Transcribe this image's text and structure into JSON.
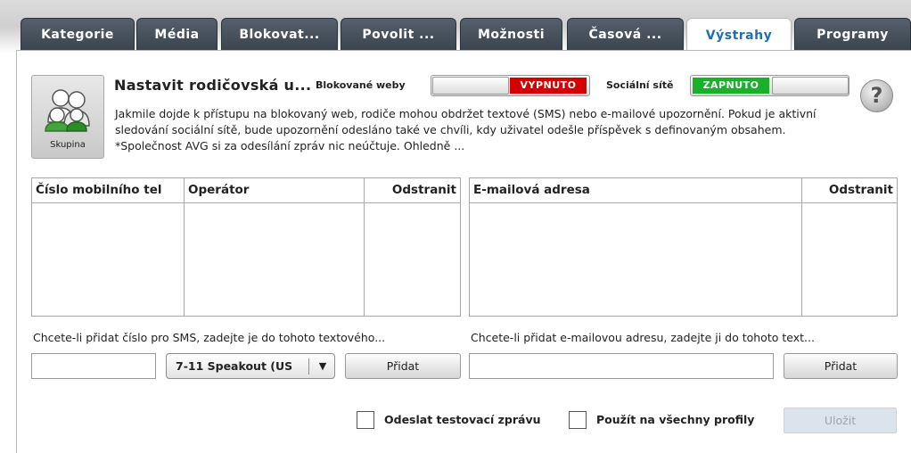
{
  "tabs": [
    {
      "label": "Kategorie"
    },
    {
      "label": "Média"
    },
    {
      "label": "Blokovat..."
    },
    {
      "label": "Povolit ..."
    },
    {
      "label": "Možnosti"
    },
    {
      "label": "Časová ..."
    },
    {
      "label": "Výstrahy",
      "active": true
    },
    {
      "label": "Programy"
    }
  ],
  "group_button": {
    "label": "Skupina",
    "icon": "group-icon"
  },
  "heading": "Nastavit rodičovská u...",
  "switches": {
    "blocked_sites": {
      "label": "Blokované weby",
      "state": "VYPNUTO",
      "color": "#d40000"
    },
    "social": {
      "label": "Sociální sítě",
      "state": "ZAPNUTO",
      "color": "#1ab02a"
    }
  },
  "help": {
    "glyph": "?"
  },
  "description": "Jakmile dojde k přístupu na blokovaný web, rodiče mohou obdržet textové (SMS) nebo e-mailové upozornění.  Pokud je aktivní sledování sociální sítě, bude upozornění odesláno také ve chvíli, kdy uživatel odešle příspěvek s definovaným obsahem.  *Společnost AVG si za odesílání zpráv nic neúčtuje.  Ohledně ...",
  "sms_table": {
    "columns": [
      "Číslo mobilního tel",
      "Operátor",
      "Odstranit"
    ],
    "rows": []
  },
  "email_table": {
    "columns": [
      "E-mailová adresa",
      "Odstranit"
    ],
    "rows": []
  },
  "sms_hint": "Chcete-li přidat číslo pro SMS, zadejte je do tohoto textového...",
  "email_hint": "Chcete-li přidat e-mailovou adresu, zadejte ji do tohoto text...",
  "sms_input": {
    "value": ""
  },
  "carrier_select": {
    "value": "7-11 Speakout (US"
  },
  "add_label": "Přidat",
  "email_input": {
    "value": ""
  },
  "test_message": {
    "label": "Odeslat testovací zprávu",
    "checked": false
  },
  "apply_all": {
    "label": "Použít na všechny profily",
    "checked": false
  },
  "save_label": "Uložit"
}
